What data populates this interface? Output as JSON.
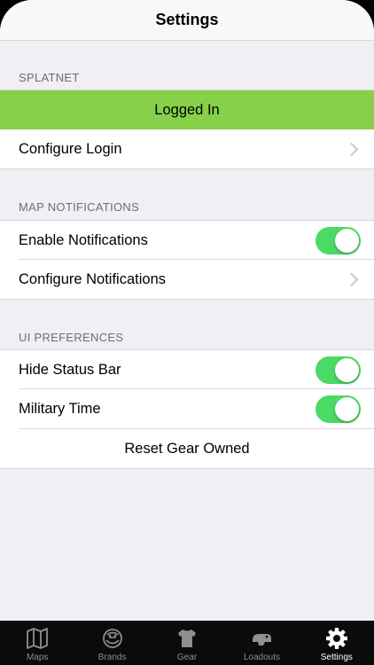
{
  "navbar": {
    "title": "Settings"
  },
  "sections": {
    "splatnet": {
      "header": "SPLATNET",
      "status": "Logged In",
      "configure_login": "Configure Login"
    },
    "map_notifications": {
      "header": "MAP NOTIFICATIONS",
      "enable": "Enable Notifications",
      "enable_on": true,
      "configure": "Configure Notifications"
    },
    "ui_preferences": {
      "header": "UI PREFERENCES",
      "hide_status_bar": "Hide Status Bar",
      "hide_status_bar_on": true,
      "military_time": "Military Time",
      "military_time_on": true,
      "reset_gear": "Reset Gear Owned"
    }
  },
  "tabbar": {
    "items": [
      {
        "label": "Maps",
        "icon": "map-icon"
      },
      {
        "label": "Brands",
        "icon": "brands-icon"
      },
      {
        "label": "Gear",
        "icon": "shirt-icon"
      },
      {
        "label": "Loadouts",
        "icon": "loadouts-icon"
      },
      {
        "label": "Settings",
        "icon": "gear-icon",
        "active": true
      }
    ]
  },
  "colors": {
    "logged_in_bg": "#86d04a",
    "toggle_on": "#4cd964",
    "tabbar_bg": "#0b0b0b"
  }
}
